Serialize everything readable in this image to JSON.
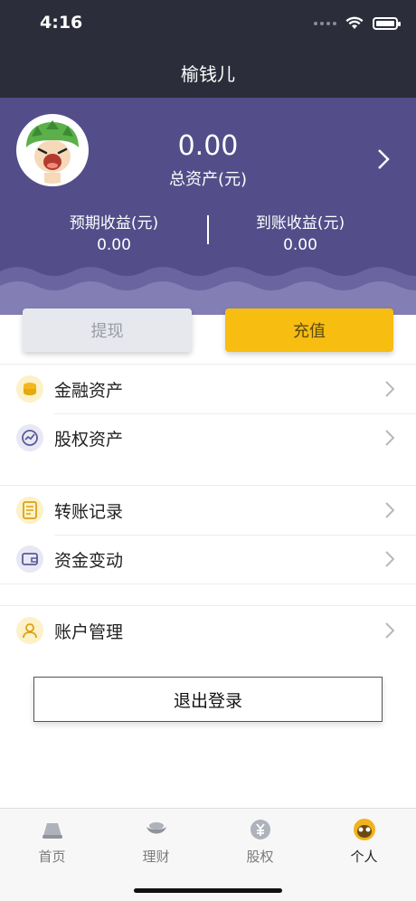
{
  "status_bar": {
    "time": "4:16"
  },
  "nav": {
    "title": "榆钱儿"
  },
  "summary": {
    "total_amount": "0.00",
    "total_label": "总资产(元)",
    "expected_label": "预期收益(元)",
    "expected_value": "0.00",
    "received_label": "到账收益(元)",
    "received_value": "0.00"
  },
  "actions": {
    "withdraw_label": "提现",
    "recharge_label": "充值"
  },
  "menu": [
    {
      "label": "金融资产",
      "icon": "coins-icon"
    },
    {
      "label": "股权资产",
      "icon": "trend-chart-icon"
    },
    {
      "label": "转账记录",
      "icon": "document-icon"
    },
    {
      "label": "资金变动",
      "icon": "wallet-icon"
    },
    {
      "label": "账户管理",
      "icon": "user-icon"
    }
  ],
  "logout_label": "退出登录",
  "tabs": [
    {
      "label": "首页",
      "icon": "home-icon",
      "active": false
    },
    {
      "label": "理财",
      "icon": "ingot-icon",
      "active": false
    },
    {
      "label": "股权",
      "icon": "yuan-icon",
      "active": false
    },
    {
      "label": "个人",
      "icon": "profile-icon",
      "active": true
    }
  ],
  "colors": {
    "header": "#534d8a",
    "topbar": "#2b2e3a",
    "accent": "#f7bd11"
  }
}
